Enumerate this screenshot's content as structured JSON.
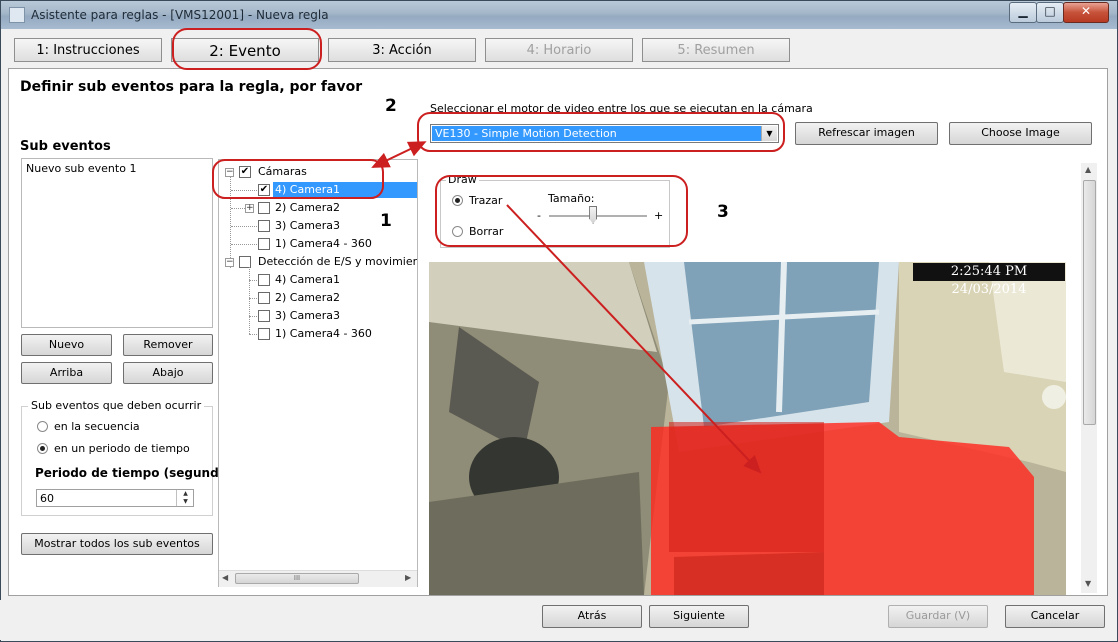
{
  "window": {
    "title": "Asistente para reglas - [VMS12001] - Nueva regla",
    "min": "▁",
    "max": "□",
    "close": "✕"
  },
  "tabs": [
    {
      "label": "1: Instrucciones"
    },
    {
      "label": "2: Evento"
    },
    {
      "label": "3: Acción"
    },
    {
      "label": "4: Horario"
    },
    {
      "label": "5: Resumen"
    }
  ],
  "heading": "Definir sub eventos para la regla, por favor",
  "sub_events": {
    "title": "Sub eventos",
    "items": [
      "Nuevo sub evento 1"
    ],
    "buttons": {
      "new": "Nuevo",
      "remove": "Remover",
      "up": "Arriba",
      "down": "Abajo"
    },
    "occur_group": {
      "title": "Sub eventos que deben ocurrir",
      "opt_sequence": "en la secuencia",
      "opt_period": "en un periodo de tiempo",
      "selected": "en un periodo de tiempo"
    },
    "period_label": "Periodo de tiempo (segundos):",
    "period_value": "60",
    "show_all": "Mostrar todos los sub eventos"
  },
  "tree": {
    "groups": [
      {
        "label": "Cámaras",
        "checked": true,
        "children": [
          "4) Camera1",
          "2) Camera2",
          "3) Camera3",
          "1) Camera4 - 360"
        ]
      },
      {
        "label": "Detección de E/S y movimiento e",
        "checked": false,
        "children": [
          "4) Camera1",
          "2) Camera2",
          "3) Camera3",
          "1) Camera4 - 360"
        ]
      }
    ],
    "selected": "4) Camera1",
    "hscroll": "III"
  },
  "engine": {
    "label": "Seleccionar el motor de video entre los que se ejecutan en la cámara",
    "selected": "VE130 - Simple Motion Detection",
    "refresh": "Refrescar imagen",
    "choose": "Choose Image"
  },
  "draw": {
    "title": "Draw",
    "opt_draw": "Trazar",
    "opt_erase": "Borrar",
    "size_label": "Tamaño:",
    "minus": "-",
    "plus": "+",
    "size_value": 0.45
  },
  "video": {
    "timestamp": "2:25:44 PM 24/03/2014"
  },
  "annotations": {
    "a1": "1",
    "a2": "2",
    "a3": "3"
  },
  "footer": {
    "back": "Atrás",
    "next": "Siguiente",
    "save": "Guardar (V)",
    "cancel": "Cancelar"
  },
  "colors": {
    "annotation": "#cc1f1f",
    "motion_zone": "#ff2a20",
    "selection": "#3399ff"
  }
}
